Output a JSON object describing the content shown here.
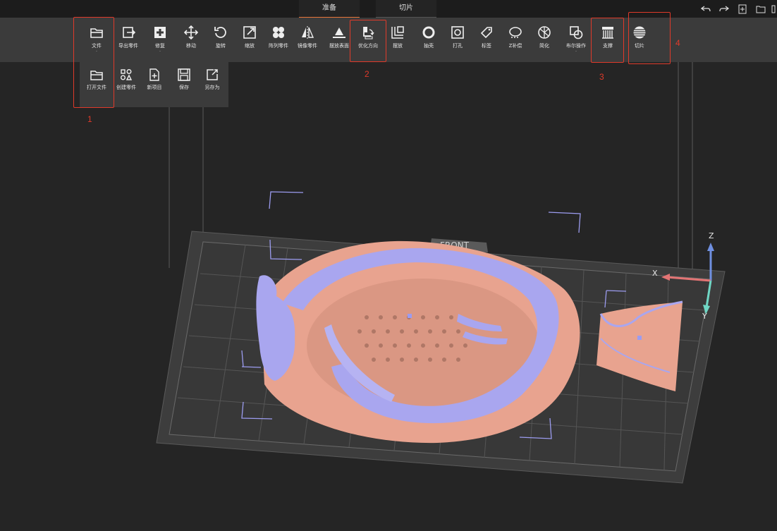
{
  "tabs": [
    {
      "label": "准备",
      "active": true
    },
    {
      "label": "切片",
      "active": false
    }
  ],
  "top_icons": [
    "undo-icon",
    "redo-icon",
    "new-file-icon",
    "open-folder-icon"
  ],
  "toolbar": {
    "items": [
      {
        "label": "文件",
        "icon": "folder-icon"
      },
      {
        "label": "导出零件",
        "icon": "export-icon"
      },
      {
        "label": "修复",
        "icon": "repair-icon"
      },
      {
        "label": "移动",
        "icon": "move-icon"
      },
      {
        "label": "旋转",
        "icon": "rotate-icon"
      },
      {
        "label": "缩放",
        "icon": "scale-icon"
      },
      {
        "label": "阵列零件",
        "icon": "array-icon"
      },
      {
        "label": "镜像零件",
        "icon": "mirror-icon"
      },
      {
        "label": "摆放表面",
        "icon": "lay-flat-icon"
      },
      {
        "label": "优化方向",
        "icon": "orient-icon"
      },
      {
        "label": "摆放",
        "icon": "arrange-icon"
      },
      {
        "label": "抽壳",
        "icon": "hollow-icon"
      },
      {
        "label": "打孔",
        "icon": "punch-icon"
      },
      {
        "label": "标签",
        "icon": "tag-icon"
      },
      {
        "label": "Z补偿",
        "icon": "z-comp-icon"
      },
      {
        "label": "简化",
        "icon": "simplify-icon"
      },
      {
        "label": "布尔操作",
        "icon": "boolean-icon"
      },
      {
        "label": "支撑",
        "icon": "support-icon"
      },
      {
        "label": "切片",
        "icon": "slice-icon"
      }
    ]
  },
  "file_menu": {
    "items": [
      {
        "label": "打开文件",
        "icon": "open-file-icon"
      },
      {
        "label": "创建零件",
        "icon": "create-part-icon"
      },
      {
        "label": "新项目",
        "icon": "new-project-icon"
      },
      {
        "label": "保存",
        "icon": "save-icon"
      },
      {
        "label": "另存为",
        "icon": "save-as-icon"
      }
    ]
  },
  "annotations": [
    "1",
    "2",
    "3",
    "4"
  ],
  "viewport": {
    "front_label": "FRONT",
    "axes": {
      "x": "X",
      "y": "Y",
      "z": "Z"
    },
    "colors": {
      "model": "#a9a6ef",
      "support": "#e8a38f",
      "plate": "#3c3c3c",
      "grid": "#6e6e6e",
      "x_axis": "#e37474",
      "y_axis": "#6fd6c4",
      "z_axis": "#6f8fe0"
    }
  }
}
